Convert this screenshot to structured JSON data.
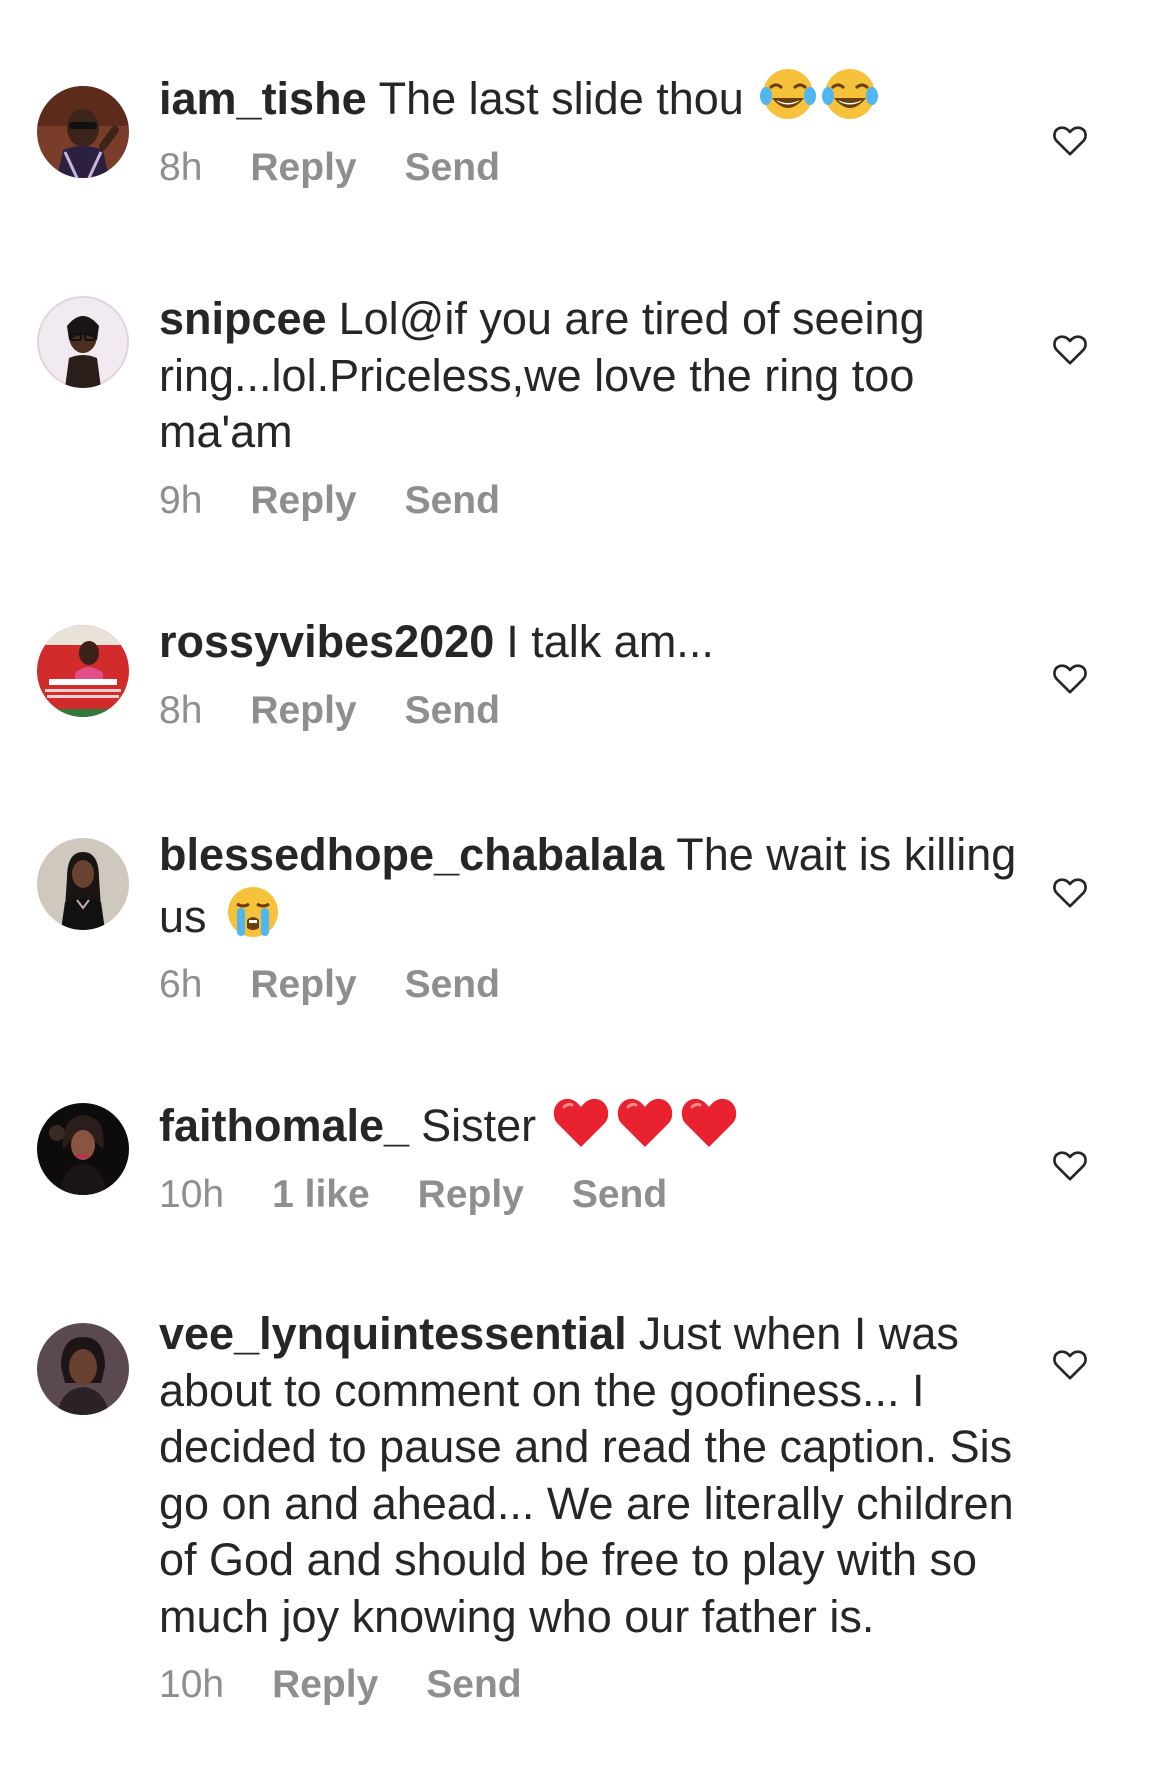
{
  "comments": [
    {
      "username": "iam_tishe",
      "text": "The last slide thou",
      "time": "8h",
      "reply_label": "Reply",
      "send_label": "Send",
      "emoji": [
        "face-with-tears-of-joy",
        "face-with-tears-of-joy"
      ],
      "avatar_color": "#6b3a2a"
    },
    {
      "username": "snipcee",
      "text": "Lol@if you are tired of seeing ring...lol.Priceless,we love the ring too ma'am",
      "time": "9h",
      "reply_label": "Reply",
      "send_label": "Send",
      "emoji": [],
      "avatar_color": "#efe6ee"
    },
    {
      "username": "rossyvibes2020",
      "text": "I talk am...",
      "time": "8h",
      "reply_label": "Reply",
      "send_label": "Send",
      "emoji": [],
      "avatar_color": "#c92a2a"
    },
    {
      "username": "blessedhope_chabalala",
      "text": "The wait is killing us",
      "time": "6h",
      "reply_label": "Reply",
      "send_label": "Send",
      "emoji": [
        "loudly-crying-face"
      ],
      "avatar_color": "#c8c0b6"
    },
    {
      "username": "faithomale_",
      "text": "Sister",
      "time": "10h",
      "likes": "1 like",
      "reply_label": "Reply",
      "send_label": "Send",
      "emoji": [
        "red-heart",
        "red-heart",
        "red-heart"
      ],
      "avatar_color": "#1e1a1a"
    },
    {
      "username": "vee_lynquintessential",
      "text": "Just when I was about to comment on the goofiness... I decided to pause and read the caption.  Sis go on and ahead... We are literally children of God and should be free to play with so much joy knowing who our father is.",
      "time": "10h",
      "reply_label": "Reply",
      "send_label": "Send",
      "emoji": [],
      "avatar_color": "#4a3a40"
    }
  ],
  "icons": {
    "like": "heart-outline-icon"
  },
  "colors": {
    "text": "#262626",
    "meta": "#8e8e8e",
    "heart_icon": "#262626"
  }
}
